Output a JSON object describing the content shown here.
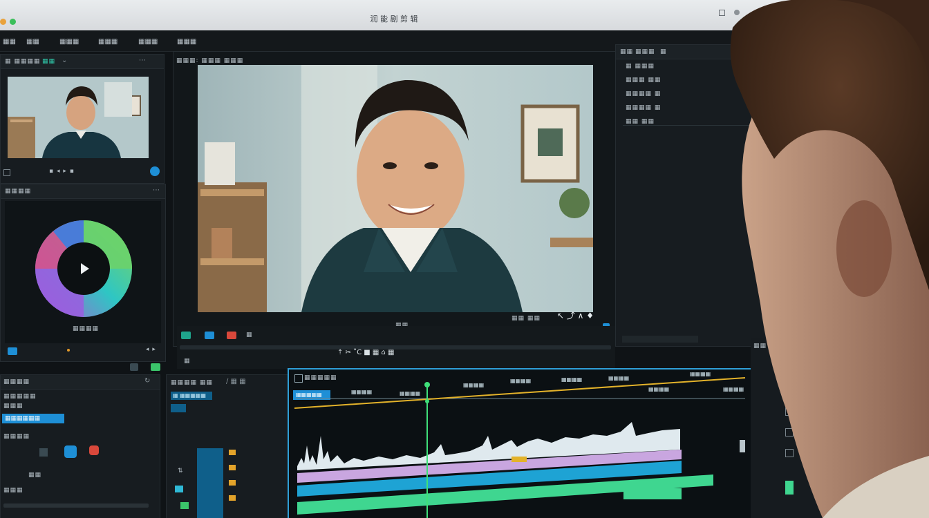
{
  "window": {
    "title": "润 能 剧 剪 辑"
  },
  "menu": [
    "▦▦",
    "▦▦",
    "▦▦▦",
    "▦▦▦",
    "▦▦▦",
    "▦▦▦"
  ],
  "media_panel": {
    "tab": "▦ ▦▦▦▦",
    "tab2": "▦▦"
  },
  "color_panel": {
    "title": "▦▦▦▦",
    "caption": "▦▦▦▦"
  },
  "viewer": {
    "label": "▦▦▦: ▦▦▦ ▦▦▦",
    "timecode": "▦▦",
    "zoom": "▦▦ ▦▦"
  },
  "inspector": {
    "tabs": [
      "▦▦",
      "▦▦▦",
      "▦"
    ],
    "rows": [
      "▦ ▦▦▦",
      "▦▦▦ ▦▦",
      "▦▦▦▦ ▦",
      "▦▦▦▦ ▦",
      "▦▦ ▦▦"
    ]
  },
  "effects_panel": {
    "title": "▦▦▦▦",
    "selected": "▦▦▦▦▦▦",
    "items": [
      "▦▦▦▦▦",
      "▦▦▦",
      "▦▦▦▦",
      "▦▦",
      "▦▦▦"
    ]
  },
  "timeline": {
    "title": "▦▦▦▦▦",
    "clip_label": "▦▦▦▦▦",
    "ruler": [
      "▦▦▦▦",
      "▦▦▦▦",
      "▦▦▦▦",
      "▦▦▦▦",
      "▦▦▦▦",
      "▦▦▦▦",
      "▦▦▦▦",
      "▦▦▦▦",
      "▦▦▦▦"
    ]
  },
  "tracks_header": {
    "title": "▦▦▦▦ ▦▦",
    "label": "▦ ▦▦▦▦▦"
  },
  "colors": {
    "accent": "#1e8fd6",
    "timeline_border": "#2f9fd8",
    "playhead": "#3fe07a"
  }
}
